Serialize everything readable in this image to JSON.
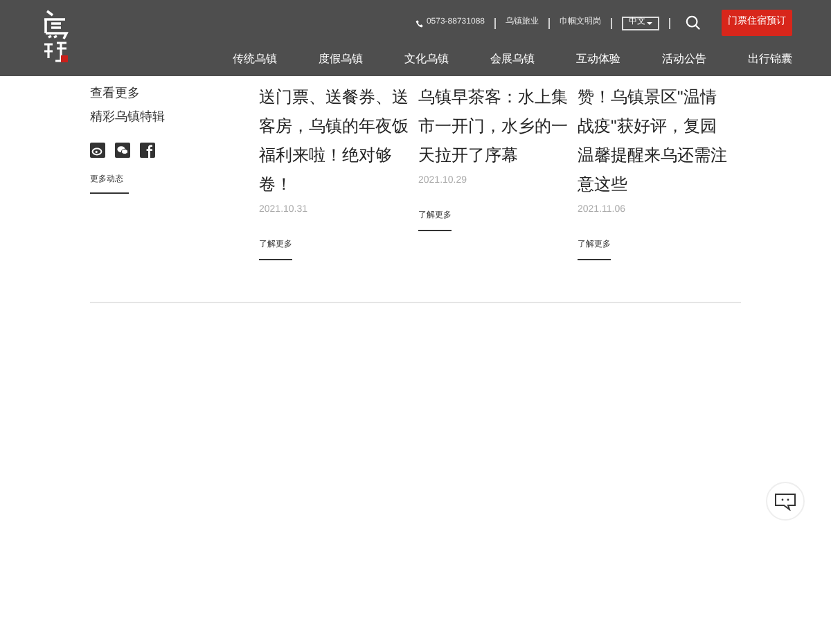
{
  "header": {
    "phone": "0573-88731088",
    "links": [
      "乌镇旅业",
      "巾帼文明岗"
    ],
    "language": "中文",
    "booking_button": "门票住宿预订",
    "nav": [
      {
        "label": "传统乌镇",
        "selected": false
      },
      {
        "label": "度假乌镇",
        "selected": false
      },
      {
        "label": "文化乌镇",
        "selected": false
      },
      {
        "label": "会展乌镇",
        "selected": false
      },
      {
        "label": "互动体验",
        "selected": false
      },
      {
        "label": "活动公告",
        "selected": false
      },
      {
        "label": "出行锦囊",
        "selected": false
      }
    ]
  },
  "sidebar": {
    "heading": "查看更多",
    "subheading": "精彩乌镇特辑",
    "more_link": "更多动态"
  },
  "articles": [
    {
      "title": "送门票、送餐券、送客房，乌镇的年夜饭福利来啦！绝对够卷！",
      "date": "2021.10.31",
      "link": "了解更多"
    },
    {
      "title": "乌镇早茶客：水上集市一开门，水乡的一天拉开了序幕",
      "date": "2021.10.29",
      "link": "了解更多"
    },
    {
      "title": "赞！乌镇景区\"温情战疫\"获好评，复园温馨提醒来乌还需注意这些",
      "date": "2021.11.06",
      "link": "了解更多"
    }
  ]
}
